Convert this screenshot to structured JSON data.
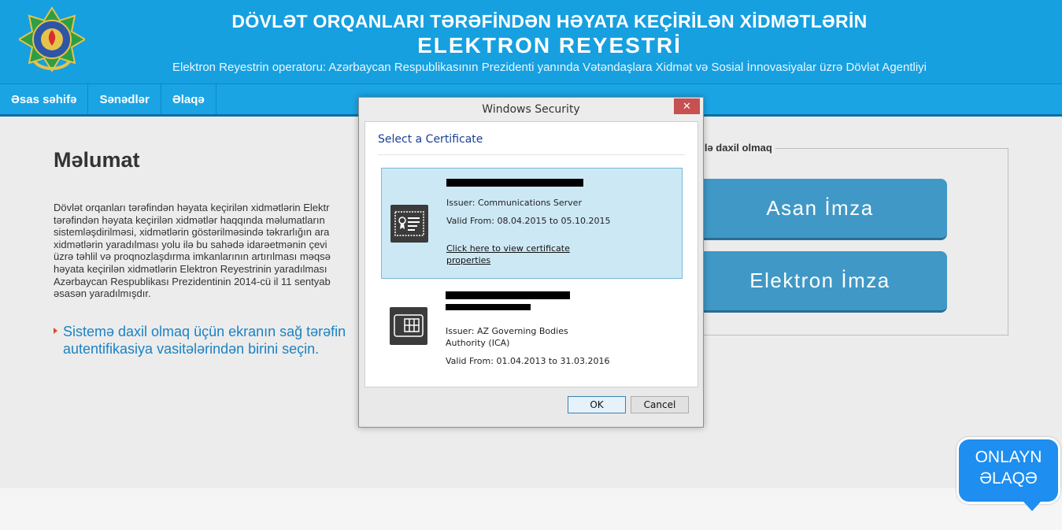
{
  "header": {
    "title_line1": "DÖVLƏT ORQANLARI TƏRƏFİNDƏN HƏYATA KEÇİRİLƏN XİDMƏTLƏRİN",
    "title_line2": "ELEKTRON   REYESTRİ",
    "subtitle": "Elektron Reyestrin operatoru: Azərbaycan Respublikasının Prezidenti yanında Vətəndaşlara Xidmət və Sosial İnnovasiyalar üzrə Dövlət Agentliyi",
    "emblem_icon": "azerbaijan-emblem-icon"
  },
  "nav": {
    "items": [
      {
        "label": "Əsas səhifə"
      },
      {
        "label": "Sənədlər"
      },
      {
        "label": "Əlaqə"
      }
    ]
  },
  "info": {
    "title": "Məlumat",
    "text": "Dövlət orqanları tərəfindən həyata keçirilən xidmətlərin Elektr\ntərəfindən həyata keçirilən xidmətlər haqqında məlumatların\nsistemləşdirilməsi, xidmətlərin göstərilməsində təkrarlığın ara\nxidmətlərin yaradılması yolu ilə bu sahədə idarəetmənin çevi\nüzrə təhlil və proqnozlaşdırma imkanlarının artırılması məqsə\nhəyata keçirilən xidmətlərin Elektron Reyestrinin yaradılması\nAzərbaycan Respublikası Prezidentinin 2014-cü il 11 sentyab\nəsasən yaradılmışdır.",
    "instruction": "Sistemə daxil olmaq üçün ekranın sağ tərəfin\nautentifikasiya vasitələrindən birini seçin."
  },
  "login": {
    "legend": "silə daxil olmaq",
    "asan_label": "Asan İmza",
    "elektron_label": "Elektron İmza"
  },
  "chat": {
    "line1": "ONLAYN",
    "line2": "ƏLAQƏ"
  },
  "dialog": {
    "title": "Windows Security",
    "close_label": "✕",
    "heading": "Select a Certificate",
    "certificates": [
      {
        "issuer": "Issuer: Communications Server",
        "valid": "Valid From: 08.04.2015 to 05.10.2015",
        "link": "Click here to view certificate properties",
        "icon": "certificate-icon"
      },
      {
        "issuer": "Issuer: AZ Governing Bodies\nAuthority (ICA)",
        "valid": "Valid From: 01.04.2013 to 31.03.2016",
        "icon": "smartcard-icon"
      }
    ],
    "ok_label": "OK",
    "cancel_label": "Cancel"
  },
  "colors": {
    "header_blue": "#16a0e0",
    "button_blue": "#4098c6",
    "chat_blue": "#1e8ef0",
    "selected_bg": "#cde8f5"
  }
}
